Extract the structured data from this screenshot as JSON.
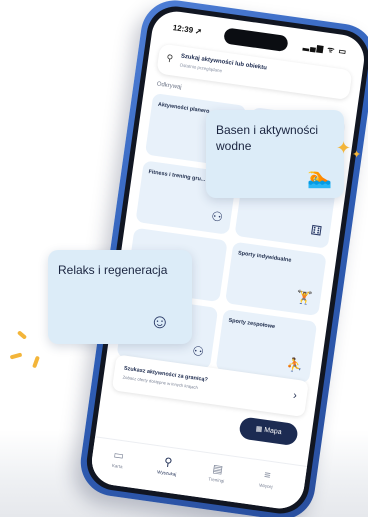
{
  "status_bar": {
    "time": "12:39 ➚",
    "system": "▂▄▆ ᯤ ▭"
  },
  "search": {
    "title": "Szukaj aktywności lub obiektu",
    "subtitle": "Ostatnio przeglądane"
  },
  "section": {
    "label": "Odkrywaj"
  },
  "tiles": [
    {
      "label": "Aktywności planero...",
      "icon": "⛹"
    },
    {
      "label": "Fitness i trening gru...",
      "icon": "⚇"
    },
    {
      "label": "",
      "icon": "⚅"
    },
    {
      "label": "Sporty indywidualne",
      "icon": "🏋"
    },
    {
      "label": "Sporty zespołowe",
      "icon": "⛹"
    },
    {
      "label": "",
      "icon": "⚇"
    }
  ],
  "abroad": {
    "title": "Szukasz aktywności za granicą?",
    "subtitle": "Zobacz oferty dostępne w innych krajach",
    "chevron": "›"
  },
  "map_button": {
    "label": "Mapa",
    "icon": "▦"
  },
  "tabbar": {
    "items": [
      {
        "label": "Karta",
        "icon": "▭"
      },
      {
        "label": "Wyszukaj",
        "icon": "⚲"
      },
      {
        "label": "Treningi",
        "icon": "▤"
      },
      {
        "label": "Więcej",
        "icon": "≡"
      }
    ]
  },
  "cards": {
    "water": {
      "label": "Basen i aktywności wodne",
      "icon": "🏊"
    },
    "relax": {
      "label": "Relaks i regeneracja",
      "icon": "☺"
    }
  },
  "colors": {
    "accent": "#f3b53a",
    "phone": "#2f5fb8",
    "card": "#dcecf8",
    "dark": "#1c2b52"
  }
}
